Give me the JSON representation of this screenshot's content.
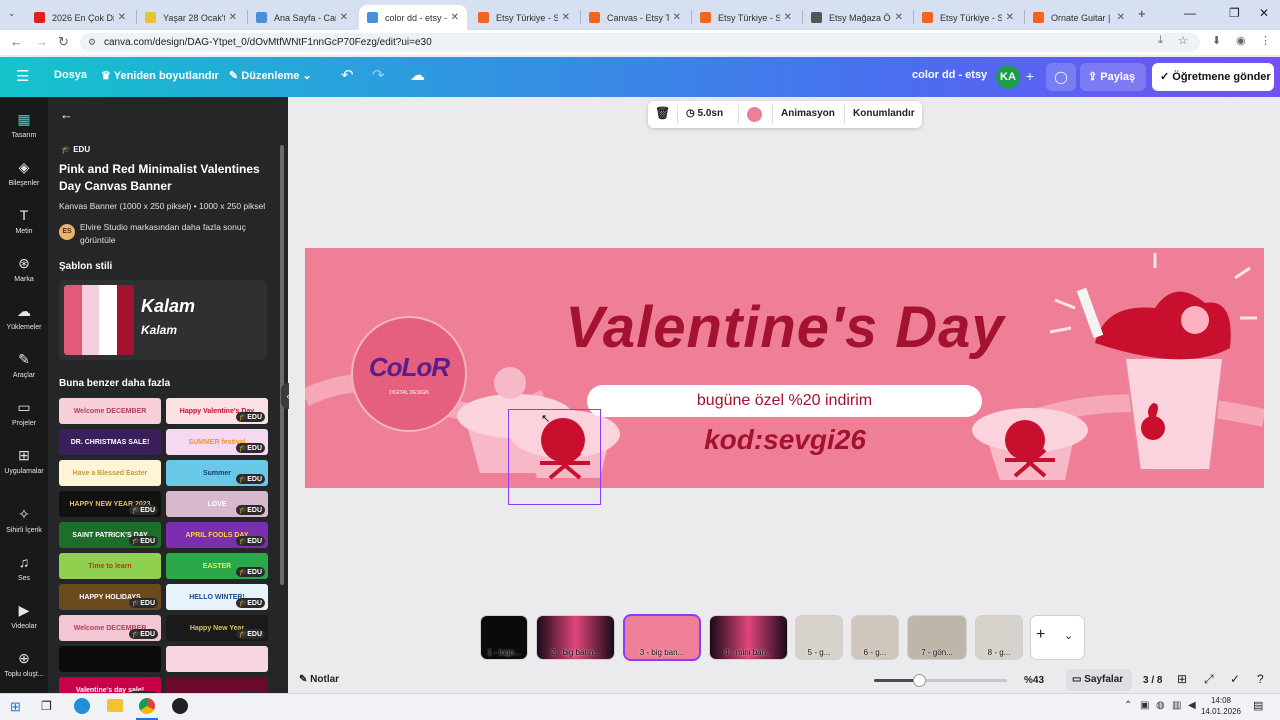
{
  "browser": {
    "tabs": [
      {
        "label": "2026 En Çok Dinle",
        "fav": "#e02020"
      },
      {
        "label": "Yaşar 28 Ocak'ta",
        "fav": "#e8c32a"
      },
      {
        "label": "Ana Sayfa - Canva",
        "fav": "#4a90d9"
      },
      {
        "label": "color dd - etsy - M",
        "fav": "#4a90d9",
        "active": true
      },
      {
        "label": "Etsy Türkiye - Sho",
        "fav": "#f1641e"
      },
      {
        "label": "Canvas - Etsy Türk",
        "fav": "#f1641e"
      },
      {
        "label": "Etsy Türkiye - Sho",
        "fav": "#f1641e"
      },
      {
        "label": "Etsy Mağaza Ölçü",
        "fav": "#555555"
      },
      {
        "label": "Etsy Türkiye - Sho",
        "fav": "#f1641e"
      },
      {
        "label": "Ornate Guitar | Se",
        "fav": "#f1641e"
      }
    ],
    "url": "canva.com/design/DAG-Ytpet_0/dOvMtfWNtF1nnGcP70Fezg/edit?ui=e30"
  },
  "topbar": {
    "file": "Dosya",
    "resize": "Yeniden boyutlandır",
    "edit": "Düzenleme",
    "design_title": "color dd - etsy",
    "avatar": "KA",
    "share": "Paylaş",
    "send_teacher": "Öğretmene gönder"
  },
  "rail": [
    {
      "label": "Tasarım",
      "icon": "design-icon"
    },
    {
      "label": "Bileşenler",
      "icon": "elements-icon"
    },
    {
      "label": "Metin",
      "icon": "text-icon"
    },
    {
      "label": "Marka",
      "icon": "brand-icon"
    },
    {
      "label": "Yüklemeler",
      "icon": "upload-icon"
    },
    {
      "label": "Araçlar",
      "icon": "draw-icon"
    },
    {
      "label": "Projeler",
      "icon": "folder-icon"
    },
    {
      "label": "Uygulamalar",
      "icon": "apps-icon"
    },
    {
      "label": "Sihirli İçerik",
      "icon": "magic-icon"
    },
    {
      "label": "Ses",
      "icon": "music-icon"
    },
    {
      "label": "Videolar",
      "icon": "video-icon"
    },
    {
      "label": "Toplu oluşt...",
      "icon": "bulk-create-icon"
    }
  ],
  "panel": {
    "edu_badge": "EDU",
    "title": "Pink and Red Minimalist Valentines Day Canvas Banner",
    "meta": "Kanvas Banner (1000 x 250 piksel) • 1000 x 250 piksel",
    "brand_initials": "ES",
    "brand_text": "Elvire Studio markasından daha fazla sonuç görüntüle",
    "style_heading": "Şablon stili",
    "style_font_1": "Kalam",
    "style_font_2": "Kalam",
    "similar_heading": "Buna benzer daha fazla",
    "thumbs": [
      {
        "text": "Welcome DECEMBER",
        "bg": "#f6cfd9",
        "fg": "#b2425f",
        "edu": false
      },
      {
        "text": "Happy Valentine's Day",
        "bg": "#fbe0e4",
        "fg": "#c8102e",
        "edu": true
      },
      {
        "text": "DR. CHRISTMAS SALE!",
        "bg": "#3a1f5c",
        "fg": "#ffffff",
        "edu": false
      },
      {
        "text": "SUMMER festival",
        "bg": "#f4d9f0",
        "fg": "#e89a2c",
        "edu": true
      },
      {
        "text": "Have a Blessed Easter",
        "bg": "#fff4d6",
        "fg": "#c59a3a",
        "edu": false
      },
      {
        "text": "Summer",
        "bg": "#69c8e8",
        "fg": "#1a3a6e",
        "edu": true
      },
      {
        "text": "HAPPY NEW YEAR 2023",
        "bg": "#111111",
        "fg": "#e0c060",
        "edu": true
      },
      {
        "text": "LOVE",
        "bg": "#d8b8cc",
        "fg": "#ffffff",
        "edu": true
      },
      {
        "text": "SAINT PATRICK'S DAY",
        "bg": "#1e6e2a",
        "fg": "#ffffff",
        "edu": true
      },
      {
        "text": "APRIL FOOLS DAY",
        "bg": "#7b2fb0",
        "fg": "#ffd23a",
        "edu": true
      },
      {
        "text": "Time to learn",
        "bg": "#8fd14f",
        "fg": "#c0341e",
        "edu": false
      },
      {
        "text": "EASTER",
        "bg": "#2aa84a",
        "fg": "#ffe14d",
        "edu": true
      },
      {
        "text": "HAPPY HOLIDAYS",
        "bg": "#6b4a1e",
        "fg": "#ffffff",
        "edu": true
      },
      {
        "text": "HELLO WINTER!",
        "bg": "#e8f2fa",
        "fg": "#1a4a8a",
        "edu": true
      },
      {
        "text": "Welcome DECEMBER",
        "bg": "#f3c6d3",
        "fg": "#b2425f",
        "edu": true
      },
      {
        "text": "Happy New Year",
        "bg": "#1a1a1a",
        "fg": "#e0c060",
        "edu": true
      },
      {
        "text": "",
        "bg": "#0b0b0b",
        "fg": "#ffffff",
        "edu": false
      },
      {
        "text": "",
        "bg": "#f8d6e0",
        "fg": "#c8102e",
        "edu": false
      },
      {
        "text": "Valentine's day sale!",
        "bg": "#c8004a",
        "fg": "#ffffff",
        "edu": true
      },
      {
        "text": "",
        "bg": "#6a0a2a",
        "fg": "#ffffff",
        "edu": true
      }
    ]
  },
  "context_bar": {
    "duration": "5.0sn",
    "color": "#ee7f97",
    "animation": "Animasyon",
    "position": "Konumlandır"
  },
  "banner": {
    "title": "Valentine's Day",
    "subtitle": "bugüne özel %20 indirim",
    "code": "kod:sevgi26",
    "logo_text": "CoLoR",
    "logo_sub": "DIGITAL DESIGN",
    "bg": "#ee7f97",
    "title_color": "#a3122f"
  },
  "pages": [
    {
      "label": "1 - logo..."
    },
    {
      "label": "2 - big bann..."
    },
    {
      "label": "3 - big ban...",
      "active": true
    },
    {
      "label": "4 - mini ban..."
    },
    {
      "label": "5 - g..."
    },
    {
      "label": "6 - g..."
    },
    {
      "label": "7 - gön..."
    },
    {
      "label": "8 - g..."
    }
  ],
  "footer": {
    "notes": "Notlar",
    "zoom": "%43",
    "zoom_level": 0.43,
    "pages_label": "Sayfalar",
    "page_counter": "3 / 8"
  },
  "taskbar": {
    "time": "14:08",
    "date": "14.01.2026"
  }
}
